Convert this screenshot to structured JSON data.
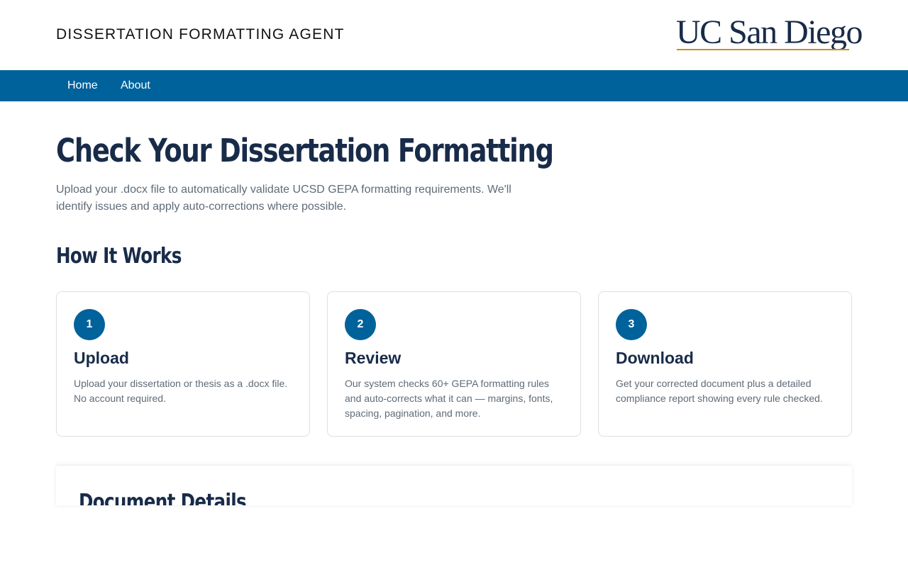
{
  "header": {
    "site_title": "DISSERTATION FORMATTING AGENT",
    "logo_text": "UC San Diego"
  },
  "nav": {
    "items": [
      {
        "label": "Home"
      },
      {
        "label": "About"
      }
    ]
  },
  "main": {
    "title": "Check Your Dissertation Formatting",
    "intro": "Upload your .docx file to automatically validate UCSD GEPA formatting requirements. We'll identify issues and apply auto-corrections where possible."
  },
  "how_it_works": {
    "title": "How It Works",
    "steps": [
      {
        "number": "1",
        "title": "Upload",
        "text": "Upload your dissertation or thesis as a .docx file. No account required."
      },
      {
        "number": "2",
        "title": "Review",
        "text": "Our system checks 60+ GEPA formatting rules and auto-corrects what it can — margins, fonts, spacing, pagination, and more."
      },
      {
        "number": "3",
        "title": "Download",
        "text": "Get your corrected document plus a detailed compliance report showing every rule checked."
      }
    ]
  },
  "document_details": {
    "title": "Document Details"
  },
  "colors": {
    "nav_blue": "#00629b",
    "navy": "#182b49",
    "gold": "#c69214"
  }
}
